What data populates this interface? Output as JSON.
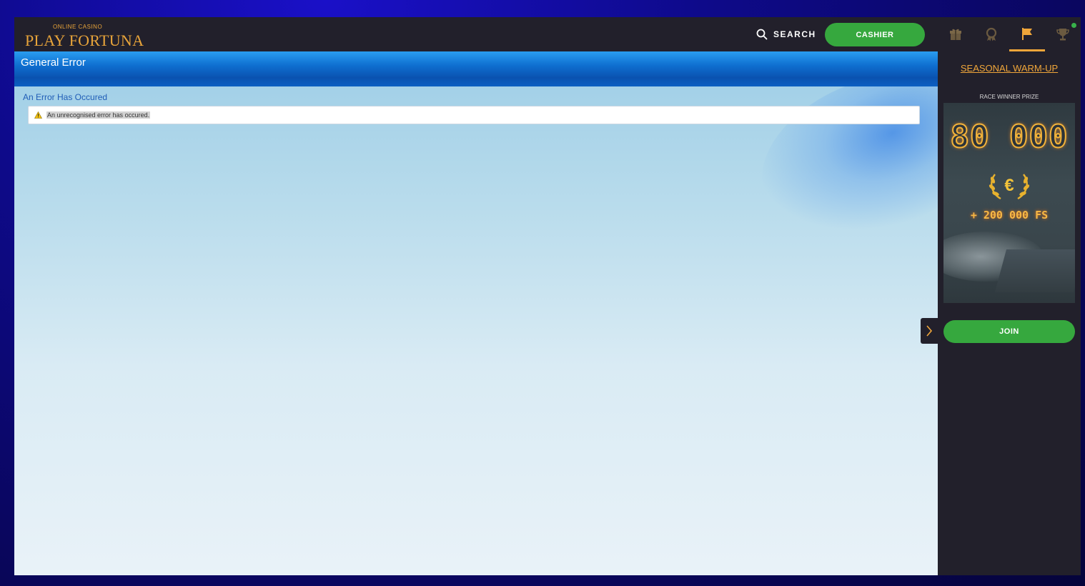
{
  "header": {
    "logo_small": "ONLINE CASINO",
    "logo_big": "PLAY FORTUNA",
    "search_label": "SEARCH",
    "cashier_label": "CASHIER",
    "icon_tabs": [
      {
        "icon": "gift-icon",
        "active": false
      },
      {
        "icon": "badge-icon",
        "active": false
      },
      {
        "icon": "flag-icon",
        "active": true
      },
      {
        "icon": "trophy-icon",
        "active": false,
        "notification": true
      }
    ]
  },
  "main": {
    "page_title": "General Error",
    "error_heading": "An Error Has Occured",
    "error_message": "An unrecognised error has occured.",
    "error_icon": "warning-icon"
  },
  "sidebar": {
    "promo_title": "SEASONAL WARM-UP",
    "prize_label": "RACE WINNER PRIZE",
    "banner_amount": "80 000",
    "banner_currency": "€",
    "banner_freespins": "+ 200 000 FS",
    "join_label": "JOIN"
  },
  "colors": {
    "accent_orange": "#f0a63a",
    "button_green": "#36a83e",
    "panel_dark": "#22202b",
    "header_blue": "#0f6fd0"
  }
}
